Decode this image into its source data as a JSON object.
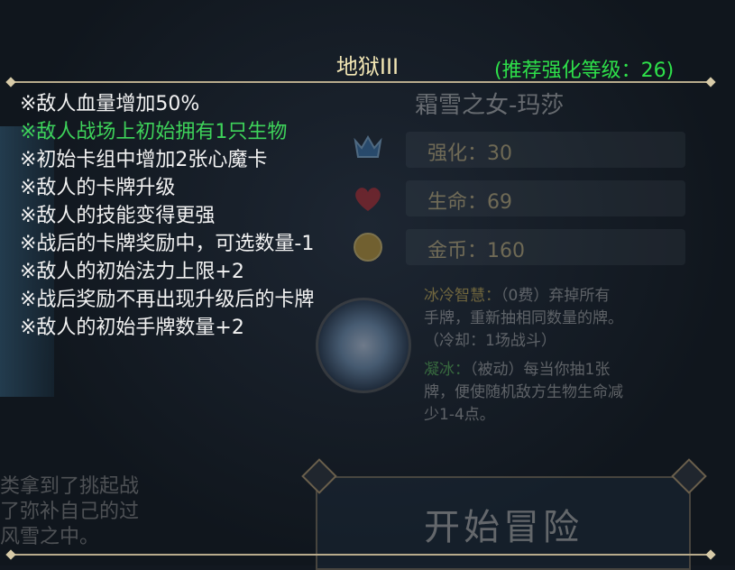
{
  "popup": {
    "title": "地狱III",
    "recommend": "(推荐强化等级：26)",
    "modifiers": [
      {
        "text": "※敌人血量增加50%",
        "highlight": false
      },
      {
        "text": "※敌人战场上初始拥有1只生物",
        "highlight": true
      },
      {
        "text": "※初始卡组中增加2张心魔卡",
        "highlight": false
      },
      {
        "text": "※敌人的卡牌升级",
        "highlight": false
      },
      {
        "text": "※敌人的技能变得更强",
        "highlight": false
      },
      {
        "text": "※战后的卡牌奖励中，可选数量-1",
        "highlight": false
      },
      {
        "text": "※敌人的初始法力上限+2",
        "highlight": false
      },
      {
        "text": "※战后奖励不再出现升级后的卡牌",
        "highlight": false
      },
      {
        "text": "※敌人的初始手牌数量+2",
        "highlight": false
      }
    ]
  },
  "hero": {
    "name": "霜雪之女-玛莎",
    "stats": {
      "enhance": "强化：30",
      "hp": "生命：69",
      "gold": "金币：160"
    },
    "skills": {
      "skill1_name": "冰冷智慧：",
      "skill1_line1": "（0费）弃掉所有",
      "skill1_line2": "手牌，重新抽相同数量的牌。",
      "skill1_line3": "（冷却：1场战斗）",
      "skill2_name": "凝冰：",
      "skill2_line1": "（被动）每当你抽1张",
      "skill2_line2": "牌，便使随机敌方生物生命减",
      "skill2_line3": "少1-4点。"
    },
    "start_button": "开始冒险"
  },
  "story": {
    "line1": "类拿到了挑起战",
    "line2": "了弥补自己的过",
    "line3": "风雪之中。"
  },
  "colors": {
    "title": "#f2e6b4",
    "recommend": "#2ee04a",
    "highlight": "#3ed35a",
    "text": "#f2f2f2",
    "frame": "#b8ab8c"
  }
}
